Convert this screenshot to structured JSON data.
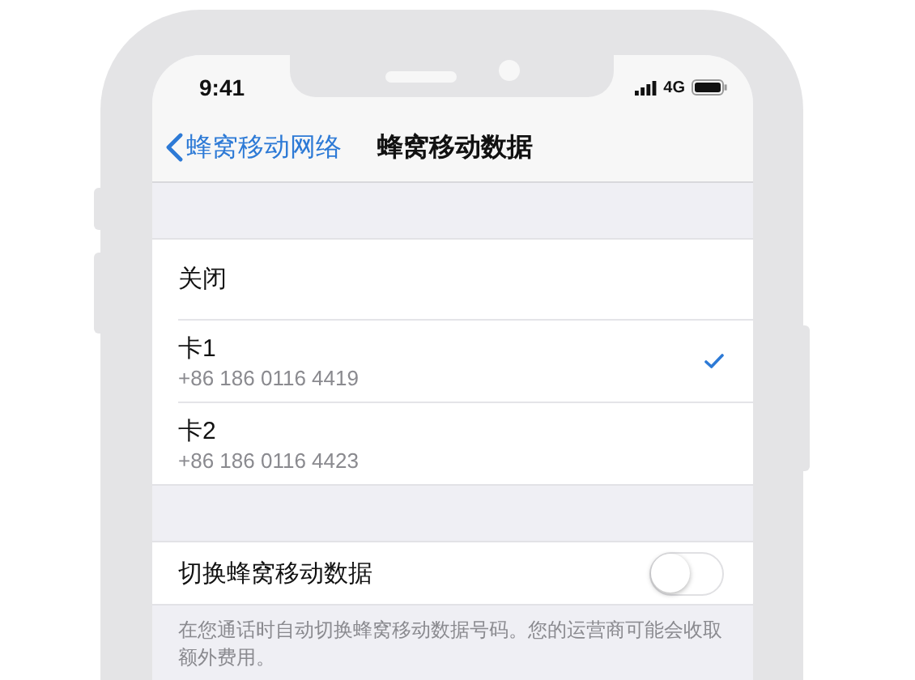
{
  "status_bar": {
    "time": "9:41",
    "network": "4G"
  },
  "nav": {
    "back": "蜂窝移动网络",
    "title": "蜂窝移动数据"
  },
  "options": [
    {
      "label": "关闭",
      "selected": false
    },
    {
      "label": "卡1",
      "detail": "+86 186 0116 4419",
      "selected": true
    },
    {
      "label": "卡2",
      "detail": "+86 186 0116 4423",
      "selected": false
    }
  ],
  "switch_row": {
    "label": "切换蜂窝移动数据",
    "on": false
  },
  "footer": "在您通话时自动切换蜂窝移动数据号码。您的运营商可能会收取额外费用。"
}
